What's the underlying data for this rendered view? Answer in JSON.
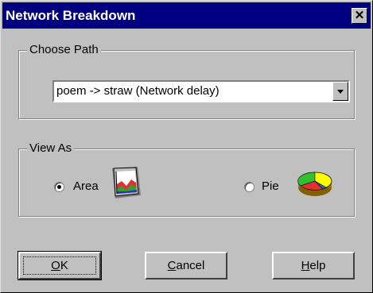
{
  "window": {
    "title": "Network Breakdown",
    "close_label": "✕"
  },
  "choose_path": {
    "group_label": "Choose Path",
    "selected": "poem -> straw (Network delay)"
  },
  "view_as": {
    "group_label": "View As",
    "options": [
      {
        "label": "Area",
        "selected": true,
        "icon": "area-chart-icon"
      },
      {
        "label": "Pie",
        "selected": false,
        "icon": "pie-chart-icon"
      }
    ]
  },
  "buttons": {
    "ok": {
      "underline": "O",
      "rest": "K"
    },
    "cancel": {
      "underline": "C",
      "rest": "ancel"
    },
    "help": {
      "underline": "H",
      "rest": "elp"
    }
  }
}
